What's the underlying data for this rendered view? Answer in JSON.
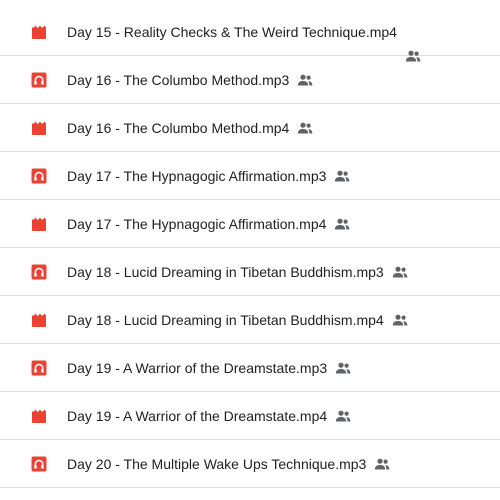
{
  "colors": {
    "video_icon": "#ea4335",
    "audio_icon": "#ea4335",
    "text": "#202124",
    "divider": "#dadce0",
    "shared_icon": "#5f6368"
  },
  "files": [
    {
      "name": "Day 15 - Reality Checks & The Weird Technique.mp4",
      "type": "video",
      "icon": "video-file-icon",
      "shared": true
    },
    {
      "name": "Day 16 - The Columbo Method.mp3",
      "type": "audio",
      "icon": "audio-file-icon",
      "shared": true
    },
    {
      "name": "Day 16 - The Columbo Method.mp4",
      "type": "video",
      "icon": "video-file-icon",
      "shared": true
    },
    {
      "name": "Day 17 - The Hypnagogic Affirmation.mp3",
      "type": "audio",
      "icon": "audio-file-icon",
      "shared": true
    },
    {
      "name": "Day 17 - The Hypnagogic Affirmation.mp4",
      "type": "video",
      "icon": "video-file-icon",
      "shared": true
    },
    {
      "name": "Day 18 - Lucid Dreaming in Tibetan Buddhism.mp3",
      "type": "audio",
      "icon": "audio-file-icon",
      "shared": true
    },
    {
      "name": "Day 18 - Lucid Dreaming in Tibetan Buddhism.mp4",
      "type": "video",
      "icon": "video-file-icon",
      "shared": true
    },
    {
      "name": "Day 19 - A Warrior of the Dreamstate.mp3",
      "type": "audio",
      "icon": "audio-file-icon",
      "shared": true
    },
    {
      "name": "Day 19 - A Warrior of the Dreamstate.mp4",
      "type": "video",
      "icon": "video-file-icon",
      "shared": true
    },
    {
      "name": "Day 20 - The Multiple Wake Ups Technique.mp3",
      "type": "audio",
      "icon": "audio-file-icon",
      "shared": true
    }
  ]
}
